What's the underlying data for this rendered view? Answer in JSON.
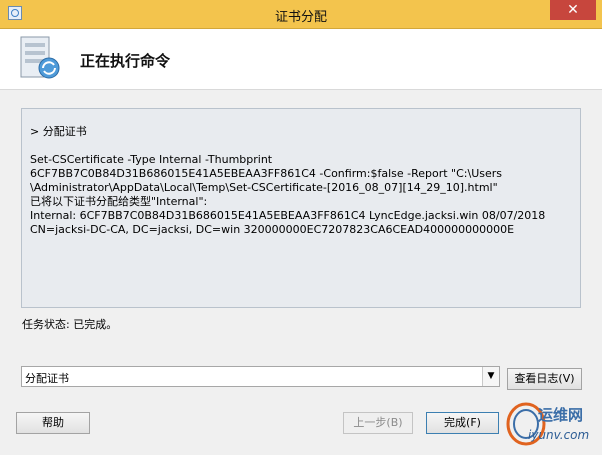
{
  "window": {
    "title": "证书分配",
    "close_symbol": "✕"
  },
  "header": {
    "title": "正在执行命令"
  },
  "log": {
    "section_heading": "> 分配证书",
    "lines": [
      "Set-CSCertificate -Type Internal -Thumbprint",
      "6CF7BB7C0B84D31B686015E41A5EBEAA3FF861C4 -Confirm:$false -Report \"C:\\Users",
      "\\Administrator\\AppData\\Local\\Temp\\Set-CSCertificate-[2016_08_07][14_29_10].html\"",
      "已将以下证书分配给类型\"Internal\":",
      "Internal: 6CF7BB7C0B84D31B686015E41A5EBEAA3FF861C4 LyncEdge.jacksi.win 08/07/2018",
      "CN=jacksi-DC-CA, DC=jacksi, DC=win 320000000EC7207823CA6CEAD400000000000E"
    ]
  },
  "status": {
    "text": "任务状态: 已完成。"
  },
  "dropdown": {
    "selected": "分配证书"
  },
  "buttons": {
    "view_log": "查看日志(V)",
    "help": "帮助",
    "back": "上一步(B)",
    "finish": "完成(F)"
  },
  "watermark": {
    "main": "运维网",
    "sub": "iyunv.com"
  },
  "colors": {
    "titlebar": "#f3c44d",
    "close": "#c7463d",
    "log_bg": "#e8ebef"
  }
}
